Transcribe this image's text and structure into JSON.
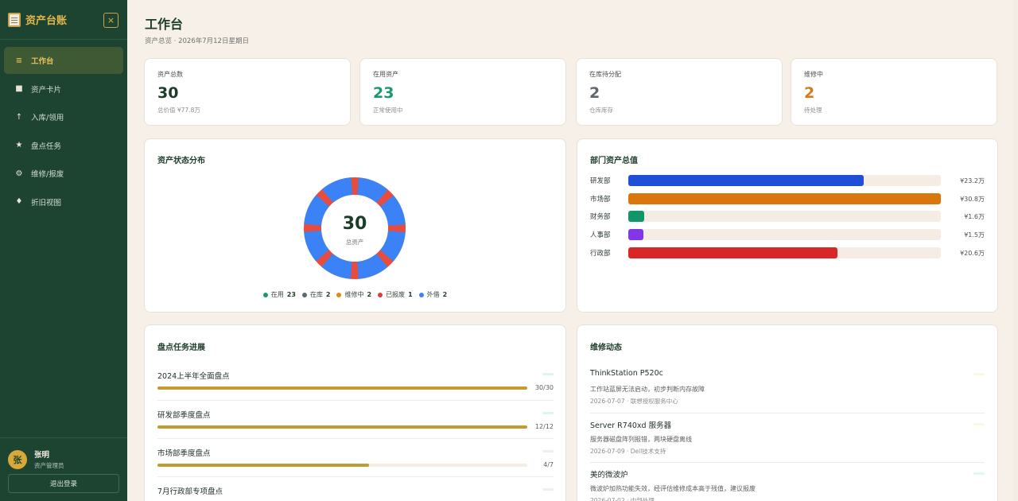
{
  "app": {
    "title": "资产台账",
    "close_icon": "×"
  },
  "nav": [
    {
      "label": "工作台",
      "icon": "≡",
      "icon_name": "menu-icon",
      "active": true
    },
    {
      "label": "资产卡片",
      "icon": "■",
      "icon_name": "card-icon",
      "active": false
    },
    {
      "label": "入库/领用",
      "icon": "↑",
      "icon_name": "arrow-up-icon",
      "active": false
    },
    {
      "label": "盘点任务",
      "icon": "★",
      "icon_name": "star-icon",
      "active": false
    },
    {
      "label": "维修/报废",
      "icon": "⚙",
      "icon_name": "gear-icon",
      "active": false
    },
    {
      "label": "折旧视图",
      "icon": "♦",
      "icon_name": "diamond-icon",
      "active": false
    }
  ],
  "user": {
    "avatar": "张",
    "name": "张明",
    "role": "资产管理员",
    "logout": "退出登录"
  },
  "page": {
    "title": "工作台",
    "subtitle": "资产总览 · 2026年7月12日星期日"
  },
  "stats": [
    {
      "label": "资产总数",
      "value": "30",
      "note": "总价值 ¥77.8万",
      "color": "#1d3d2b"
    },
    {
      "label": "在用资产",
      "value": "23",
      "note": "正常使用中",
      "color": "#1a9a6c"
    },
    {
      "label": "在库待分配",
      "value": "2",
      "note": "仓库库存",
      "color": "#5f6670"
    },
    {
      "label": "维修中",
      "value": "2",
      "note": "待处理",
      "color": "#d77a1a"
    }
  ],
  "status_panel": {
    "title": "资产状态分布",
    "total": "30",
    "total_label": "总资产",
    "legend": [
      {
        "label": "在用",
        "count": "23",
        "color": "#1a9a6c"
      },
      {
        "label": "在库",
        "count": "2",
        "color": "#5f6670"
      },
      {
        "label": "维修中",
        "count": "2",
        "color": "#e58a14"
      },
      {
        "label": "已报废",
        "count": "1",
        "color": "#dc3e34"
      },
      {
        "label": "外借",
        "count": "2",
        "color": "#3b82f6"
      }
    ]
  },
  "dept_panel": {
    "title": "部门资产总值",
    "rows": [
      {
        "name": "研发部",
        "value": "¥23.2万",
        "amount": 23.2,
        "color": "#1f4fd6"
      },
      {
        "name": "市场部",
        "value": "¥30.8万",
        "amount": 30.8,
        "color": "#d9770e"
      },
      {
        "name": "财务部",
        "value": "¥1.6万",
        "amount": 1.6,
        "color": "#119669"
      },
      {
        "name": "人事部",
        "value": "¥1.5万",
        "amount": 1.5,
        "color": "#8236e8"
      },
      {
        "name": "行政部",
        "value": "¥20.6万",
        "amount": 20.6,
        "color": "#d92626"
      }
    ]
  },
  "task_panel": {
    "title": "盘点任务进展",
    "tasks": [
      {
        "name": "2024上半年全面盘点",
        "progress": "30/30",
        "ratio": 1.0,
        "badge": "green"
      },
      {
        "name": "研发部季度盘点",
        "progress": "12/12",
        "ratio": 1.0,
        "badge": "green"
      },
      {
        "name": "市场部季度盘点",
        "progress": "4/7",
        "ratio": 0.571,
        "badge": "grey"
      },
      {
        "name": "7月行政部专项盘点",
        "progress": "",
        "ratio": 0,
        "badge": "grey"
      }
    ]
  },
  "repair_panel": {
    "title": "维修动态",
    "items": [
      {
        "title": "ThinkStation P520c",
        "desc": "工作站蓝屏无法启动，初步判断内存故障",
        "meta": "2026-07-07 · 联想授权服务中心",
        "badge": "yellow"
      },
      {
        "title": "Server R740xd 服务器",
        "desc": "服务器磁盘阵列报错，两块硬盘离线",
        "meta": "2026-07-09 · Dell技术支持",
        "badge": "yellow"
      },
      {
        "title": "美的微波炉",
        "desc": "微波炉加热功能失效，经评估维修成本高于残值，建议报废",
        "meta": "2026-07-02 · 内部处理",
        "badge": "teal"
      }
    ]
  }
}
